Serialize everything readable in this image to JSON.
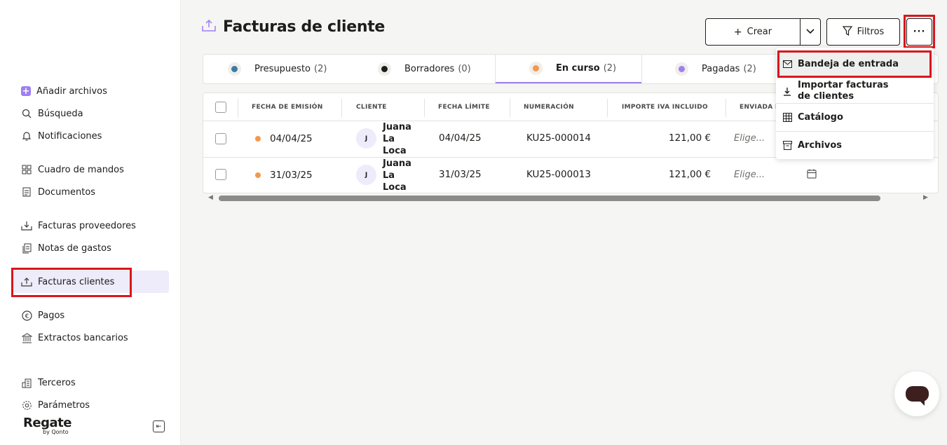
{
  "sidebar": {
    "items": [
      {
        "label": "Añadir archivos",
        "icon": "plus-icon"
      },
      {
        "label": "Búsqueda",
        "icon": "search-icon"
      },
      {
        "label": "Notificaciones",
        "icon": "bell-icon"
      },
      {
        "label": "Cuadro de mandos",
        "icon": "grid-icon"
      },
      {
        "label": "Documentos",
        "icon": "document-icon"
      },
      {
        "label": "Facturas proveedores",
        "icon": "download-tray-icon"
      },
      {
        "label": "Notas de gastos",
        "icon": "receipt-icon"
      },
      {
        "label": "Facturas clientes",
        "icon": "upload-tray-icon"
      },
      {
        "label": "Pagos",
        "icon": "euro-icon"
      },
      {
        "label": "Extractos bancarios",
        "icon": "bank-icon"
      },
      {
        "label": "Terceros",
        "icon": "building-icon"
      },
      {
        "label": "Parámetros",
        "icon": "gear-icon"
      }
    ],
    "active_item": "Facturas clientes",
    "brand": {
      "name": "Regate",
      "sub": "by Qonto"
    }
  },
  "header": {
    "title": "Facturas de cliente",
    "create_label": "Crear",
    "filters_label": "Filtros",
    "more_label": "···"
  },
  "tabs": [
    {
      "label": "Presupuesto",
      "count": "(2)",
      "color": "#3a7ca5"
    },
    {
      "label": "Borradores",
      "count": "(0)",
      "color": "#1d1d1b"
    },
    {
      "label": "En curso",
      "count": "(2)",
      "color": "#f4984d"
    },
    {
      "label": "Pagadas",
      "count": "(2)",
      "color": "#9e7ff1"
    }
  ],
  "table": {
    "headers": [
      "FECHA DE EMISIÓN",
      "CLIENTE",
      "FECHA LÍMITE",
      "NUMERACIÓN",
      "IMPORTE IVA INCLUIDO",
      "ENVIADA E"
    ],
    "rows": [
      {
        "issue_date": "04/04/25",
        "avatar": "J",
        "client_lines": [
          "Juana",
          "La",
          "Loca"
        ],
        "due_date": "04/04/25",
        "number": "KU25-000014",
        "amount": "121,00 €",
        "sent": "Elige..."
      },
      {
        "issue_date": "31/03/25",
        "avatar": "J",
        "client_lines": [
          "Juana",
          "La",
          "Loca"
        ],
        "due_date": "31/03/25",
        "number": "KU25-000013",
        "amount": "121,00 €",
        "sent": "Elige..."
      }
    ]
  },
  "menu": {
    "items": [
      {
        "label": "Bandeja de entrada",
        "icon": "mail-icon"
      },
      {
        "label": "Importar facturas de clientes",
        "icon": "import-icon"
      },
      {
        "label": "Catálogo",
        "icon": "catalog-icon"
      },
      {
        "label": "Archivos",
        "icon": "archive-icon"
      }
    ]
  },
  "colors": {
    "accent": "#9e7ff1",
    "highlight": "#d9161c",
    "status_in_progress": "#f4984d"
  }
}
